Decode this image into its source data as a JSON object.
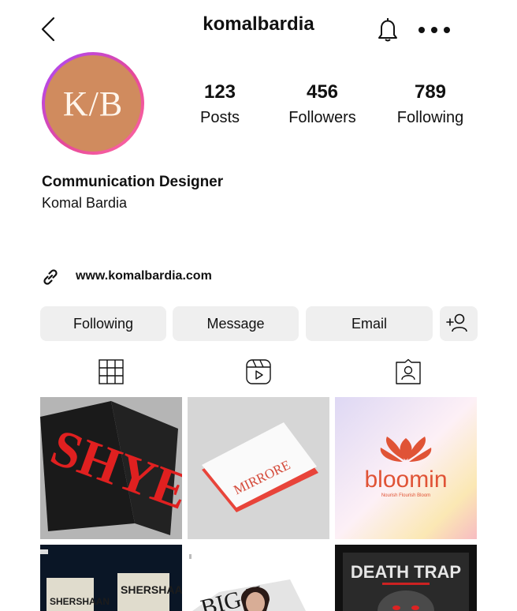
{
  "header": {
    "username": "komalbardia",
    "back_icon": "chevron-left-icon",
    "bell_icon": "bell-icon",
    "more_icon": "more-horizontal-icon"
  },
  "profile": {
    "avatar_text": "K/B",
    "avatar_color": "#d08b5e",
    "stats": [
      {
        "value": "123",
        "label": "Posts"
      },
      {
        "value": "456",
        "label": "Followers"
      },
      {
        "value": "789",
        "label": "Following"
      }
    ],
    "bio_title": "Communication Designer",
    "bio_name": "Komal Bardia",
    "website": "www.komalbardia.com",
    "link_icon": "link-icon"
  },
  "actions": {
    "following_label": "Following",
    "message_label": "Message",
    "email_label": "Email",
    "add_user_icon": "add-user-icon"
  },
  "tabs": [
    {
      "icon": "grid-icon"
    },
    {
      "icon": "reels-icon"
    },
    {
      "icon": "tagged-icon"
    }
  ],
  "posts": [
    {
      "caption": "SHYE"
    },
    {
      "caption": "MIRRORE"
    },
    {
      "caption": "bloomin",
      "subcaption": "Nourish Flourish Bloom"
    },
    {
      "caption": "SHERSHAAN"
    },
    {
      "caption": "BIG X"
    },
    {
      "caption": "DEATH TRAP"
    }
  ]
}
